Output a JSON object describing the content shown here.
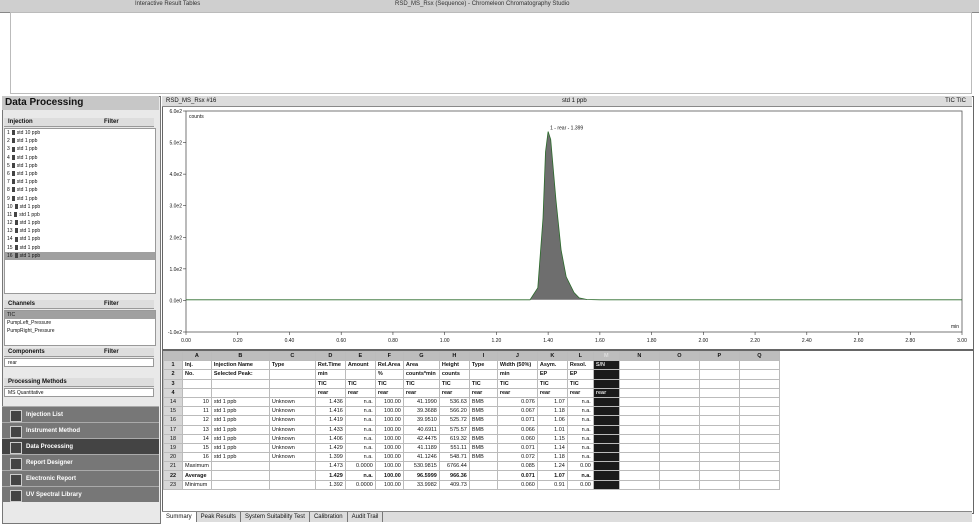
{
  "window": {
    "left_title": "Interactive Result Tables",
    "title": "RSD_MS_Rsx (Sequence) - Chromeleon Chromatography Studio"
  },
  "sidebar": {
    "title": "Data Processing",
    "injection": {
      "label": "Injection",
      "filter": "Filter",
      "items": [
        {
          "num": "1",
          "name": "std 10 ppb"
        },
        {
          "num": "2",
          "name": "std 1 ppb"
        },
        {
          "num": "3",
          "name": "std 1 ppb"
        },
        {
          "num": "4",
          "name": "std 1 ppb"
        },
        {
          "num": "5",
          "name": "std 1 ppb"
        },
        {
          "num": "6",
          "name": "std 1 ppb"
        },
        {
          "num": "7",
          "name": "std 1 ppb"
        },
        {
          "num": "8",
          "name": "std 1 ppb"
        },
        {
          "num": "9",
          "name": "std 1 ppb"
        },
        {
          "num": "10",
          "name": "std 1 ppb"
        },
        {
          "num": "11",
          "name": "std 1 ppb"
        },
        {
          "num": "12",
          "name": "std 1 ppb"
        },
        {
          "num": "13",
          "name": "std 1 ppb"
        },
        {
          "num": "14",
          "name": "std 1 ppb"
        },
        {
          "num": "15",
          "name": "std 1 ppb"
        },
        {
          "num": "16",
          "name": "std 1 ppb"
        }
      ]
    },
    "channels": {
      "label": "Channels",
      "filter": "Filter",
      "items": [
        "TIC",
        "PumpLeft_Pressure",
        "PumpRight_Pressure"
      ]
    },
    "components": {
      "label": "Components",
      "filter": "Filter",
      "item": "rear"
    },
    "processing": {
      "label": "Processing Methods",
      "item": "MS Quantitative"
    },
    "nav": [
      "Injection List",
      "Instrument Method",
      "Data Processing",
      "Report Designer",
      "Electronic Report",
      "UV Spectral Library"
    ]
  },
  "chart": {
    "header_left": "RSD_MS_Rsx #16",
    "header_center": "std 1 ppb",
    "header_right": "TIC TIC",
    "y_unit": "counts",
    "x_unit": "min",
    "peak_label": "1 - rear - 1.399"
  },
  "chart_data": {
    "type": "line",
    "ylabel": "counts",
    "xlabel": "min",
    "xlim": [
      0.0,
      3.0
    ],
    "ylim": [
      -100.0,
      600.0
    ],
    "x_ticks": [
      "0.00",
      "0.20",
      "0.40",
      "0.60",
      "0.80",
      "1.00",
      "1.20",
      "1.40",
      "1.60",
      "1.80",
      "2.00",
      "2.20",
      "2.40",
      "2.60",
      "2.80",
      "3.00"
    ],
    "y_ticks": [
      "-1.0e2",
      "0.0e0",
      "1.0e2",
      "2.0e2",
      "3.0e2",
      "4.0e2",
      "5.0e2",
      "6.0e2"
    ],
    "series": [
      {
        "x": [
          0.0,
          0.6,
          1.2,
          1.33,
          1.36,
          1.38,
          1.39,
          1.4,
          1.41,
          1.43,
          1.45,
          1.47,
          1.5,
          1.52,
          1.55,
          1.6,
          2.0,
          3.0
        ],
        "y": [
          2,
          2,
          2,
          2,
          40,
          260,
          470,
          535,
          510,
          320,
          160,
          75,
          25,
          8,
          3,
          2,
          2,
          2
        ]
      }
    ]
  },
  "sheet": {
    "columns": [
      "A",
      "B",
      "C",
      "D",
      "E",
      "F",
      "G",
      "H",
      "I",
      "J",
      "K",
      "L",
      "M",
      "N",
      "O",
      "P",
      "Q"
    ],
    "header_rows": [
      [
        "Inj.",
        "Injection Name",
        "Type",
        "Ret.Time",
        "Amount",
        "Rel.Area",
        "Area",
        "Height",
        "Type",
        "Width (50%)",
        "Asym.",
        "Resol.",
        "S/N"
      ],
      [
        "No.",
        "Selected Peak:",
        "",
        "min",
        "",
        "%",
        "counts*min",
        "counts",
        "",
        "min",
        "EP",
        "EP",
        ""
      ],
      [
        "",
        "",
        "",
        "TIC",
        "TIC",
        "TIC",
        "TIC",
        "TIC",
        "TIC",
        "TIC",
        "TIC",
        "TIC",
        ""
      ],
      [
        "",
        "",
        "",
        "rear",
        "rear",
        "rear",
        "rear",
        "rear",
        "rear",
        "rear",
        "rear",
        "rear",
        "rear"
      ]
    ],
    "rows": [
      {
        "rn": "14",
        "d": [
          "10",
          "std 1 ppb",
          "Unknown",
          "1.436",
          "n.a.",
          "100.00",
          "41.1990",
          "536.63",
          "BMB",
          "0.076",
          "1.07",
          "n.a."
        ]
      },
      {
        "rn": "15",
        "d": [
          "11",
          "std 1 ppb",
          "Unknown",
          "1.416",
          "n.a.",
          "100.00",
          "39.3688",
          "566.20",
          "BMB",
          "0.067",
          "1.18",
          "n.a."
        ]
      },
      {
        "rn": "16",
        "d": [
          "12",
          "std 1 ppb",
          "Unknown",
          "1.419",
          "n.a.",
          "100.00",
          "39.9510",
          "525.72",
          "BMB",
          "0.071",
          "1.06",
          "n.a."
        ]
      },
      {
        "rn": "17",
        "d": [
          "13",
          "std 1 ppb",
          "Unknown",
          "1.433",
          "n.a.",
          "100.00",
          "40.6911",
          "575.57",
          "BMB",
          "0.066",
          "1.01",
          "n.a."
        ]
      },
      {
        "rn": "18",
        "d": [
          "14",
          "std 1 ppb",
          "Unknown",
          "1.406",
          "n.a.",
          "100.00",
          "42.4475",
          "619.32",
          "BMB",
          "0.060",
          "1.15",
          "n.a."
        ]
      },
      {
        "rn": "19",
        "d": [
          "15",
          "std 1 ppb",
          "Unknown",
          "1.429",
          "n.a.",
          "100.00",
          "41.1189",
          "551.11",
          "BMB",
          "0.071",
          "1.14",
          "n.a."
        ]
      },
      {
        "rn": "20",
        "d": [
          "16",
          "std 1 ppb",
          "Unknown",
          "1.399",
          "n.a.",
          "100.00",
          "41.1246",
          "548.71",
          "BMB",
          "0.072",
          "1.18",
          "n.a."
        ]
      }
    ],
    "stats": [
      {
        "rn": "21",
        "label": "Maximum",
        "d": [
          "1.473",
          "0.0000",
          "100.00",
          "530.9815",
          "6766.44",
          "",
          "0.085",
          "1.24",
          "0.00"
        ]
      },
      {
        "rn": "22",
        "label": "Average",
        "d": [
          "1.429",
          "n.a.",
          "100.00",
          "96.5999",
          "966.36",
          "",
          "0.071",
          "1.07",
          "n.a."
        ]
      },
      {
        "rn": "23",
        "label": "Minimum",
        "d": [
          "1.392",
          "0.0000",
          "100.00",
          "33.9982",
          "409.73",
          "",
          "0.060",
          "0.91",
          "0.00"
        ]
      }
    ]
  },
  "tabs": [
    "Summary",
    "Peak Results",
    "System Suitability Test",
    "Calibration",
    "Audit Trail"
  ]
}
